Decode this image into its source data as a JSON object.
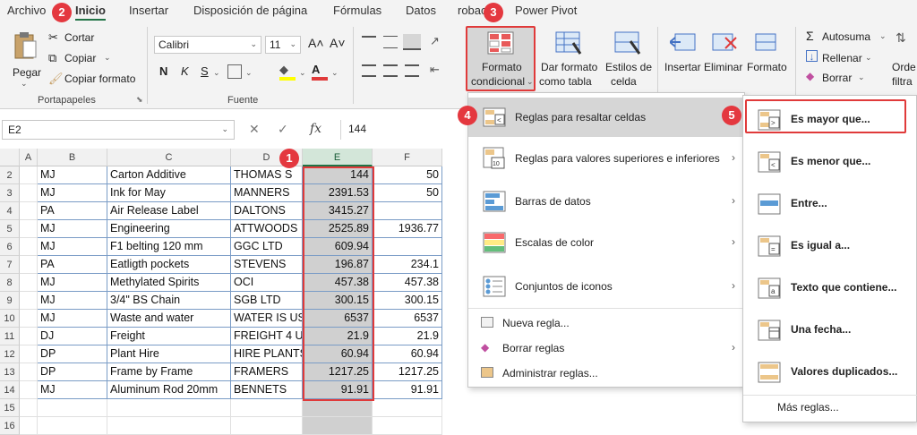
{
  "ribbon_tabs": [
    "Archivo",
    "Inicio",
    "Insertar",
    "Disposición de página",
    "Fórmulas",
    "Datos",
    "robac",
    "Power Pivot"
  ],
  "clipboard": {
    "paste": "Pegar",
    "cut": "Cortar",
    "copy": "Copiar",
    "format_painter": "Copiar formato",
    "group": "Portapapeles"
  },
  "font": {
    "name": "Calibri",
    "size": "11",
    "grow": "A˄",
    "shrink": "A˅",
    "bold": "N",
    "italic": "K",
    "underline": "S",
    "group": "Fuente"
  },
  "styles": {
    "conditional": "Formato",
    "conditional2": "condicional",
    "table": "Dar formato",
    "table2": "como tabla",
    "cell": "Estilos de",
    "cell2": "celda"
  },
  "cells": {
    "insert": "Insertar",
    "delete": "Eliminar",
    "format": "Formato"
  },
  "editing": {
    "autosum": "Autosuma",
    "fill": "Rellenar",
    "clear": "Borrar",
    "sort": "Orde",
    "sort2": "filtra"
  },
  "formula_bar": {
    "namebox": "E2",
    "fx": "fx",
    "value": "144"
  },
  "columns": [
    "A",
    "B",
    "C",
    "D",
    "E",
    "F"
  ],
  "rows": [
    {
      "n": "2",
      "b": "MJ",
      "c": "Carton Additive",
      "d": "THOMAS S",
      "e": "144",
      "f": "50"
    },
    {
      "n": "3",
      "b": "MJ",
      "c": "Ink for May",
      "d": "MANNERS",
      "e": "2391.53",
      "f": "50"
    },
    {
      "n": "4",
      "b": "PA",
      "c": "Air Release Label",
      "d": "DALTONS",
      "e": "3415.27",
      "f": ""
    },
    {
      "n": "5",
      "b": "MJ",
      "c": "Engineering",
      "d": "ATTWOODS",
      "e": "2525.89",
      "f": "1936.77"
    },
    {
      "n": "6",
      "b": "MJ",
      "c": "F1 belting 120 mm",
      "d": "GGC LTD",
      "e": "609.94",
      "f": ""
    },
    {
      "n": "7",
      "b": "PA",
      "c": "Eatligth pockets",
      "d": "STEVENS",
      "e": "196.87",
      "f": "234.1"
    },
    {
      "n": "8",
      "b": "MJ",
      "c": "Methylated Spirits",
      "d": "OCI",
      "e": "457.38",
      "f": "457.38"
    },
    {
      "n": "9",
      "b": "MJ",
      "c": "3/4\" BS Chain",
      "d": "SGB LTD",
      "e": "300.15",
      "f": "300.15"
    },
    {
      "n": "10",
      "b": "MJ",
      "c": "Waste and water",
      "d": "WATER IS US",
      "e": "6537",
      "f": "6537"
    },
    {
      "n": "11",
      "b": "DJ",
      "c": "Freight",
      "d": "FREIGHT 4 U",
      "e": "21.9",
      "f": "21.9"
    },
    {
      "n": "12",
      "b": "DP",
      "c": "Plant Hire",
      "d": "HIRE PLANTS",
      "e": "60.94",
      "f": "60.94"
    },
    {
      "n": "13",
      "b": "DP",
      "c": "Frame by Frame",
      "d": "FRAMERS",
      "e": "1217.25",
      "f": "1217.25"
    },
    {
      "n": "14",
      "b": "MJ",
      "c": "Aluminum Rod 20mm",
      "d": "BENNETS",
      "e": "91.91",
      "f": "91.91"
    },
    {
      "n": "15",
      "b": "",
      "c": "",
      "d": "",
      "e": "",
      "f": ""
    },
    {
      "n": "16",
      "b": "",
      "c": "",
      "d": "",
      "e": "",
      "f": ""
    }
  ],
  "menu": [
    {
      "label": "Reglas para resaltar celdas",
      "submenu": true
    },
    {
      "label": "Reglas para valores superiores e inferiores",
      "submenu": true
    },
    {
      "label": "Barras de datos",
      "submenu": true
    },
    {
      "label": "Escalas de color",
      "submenu": true
    },
    {
      "label": "Conjuntos de iconos",
      "submenu": true
    }
  ],
  "menu_small": [
    {
      "label": "Nueva regla..."
    },
    {
      "label": "Borrar reglas"
    },
    {
      "label": "Administrar reglas..."
    }
  ],
  "submenu": [
    {
      "label": "Es mayor que..."
    },
    {
      "label": "Es menor que..."
    },
    {
      "label": "Entre..."
    },
    {
      "label": "Es igual a..."
    },
    {
      "label": "Texto que contiene..."
    },
    {
      "label": "Una fecha..."
    },
    {
      "label": "Valores duplicados..."
    }
  ],
  "submenu_more": "Más reglas...",
  "badges": [
    "1",
    "2",
    "3",
    "4",
    "5"
  ],
  "colors": {
    "accent": "#217346",
    "badge": "#e4383f"
  }
}
